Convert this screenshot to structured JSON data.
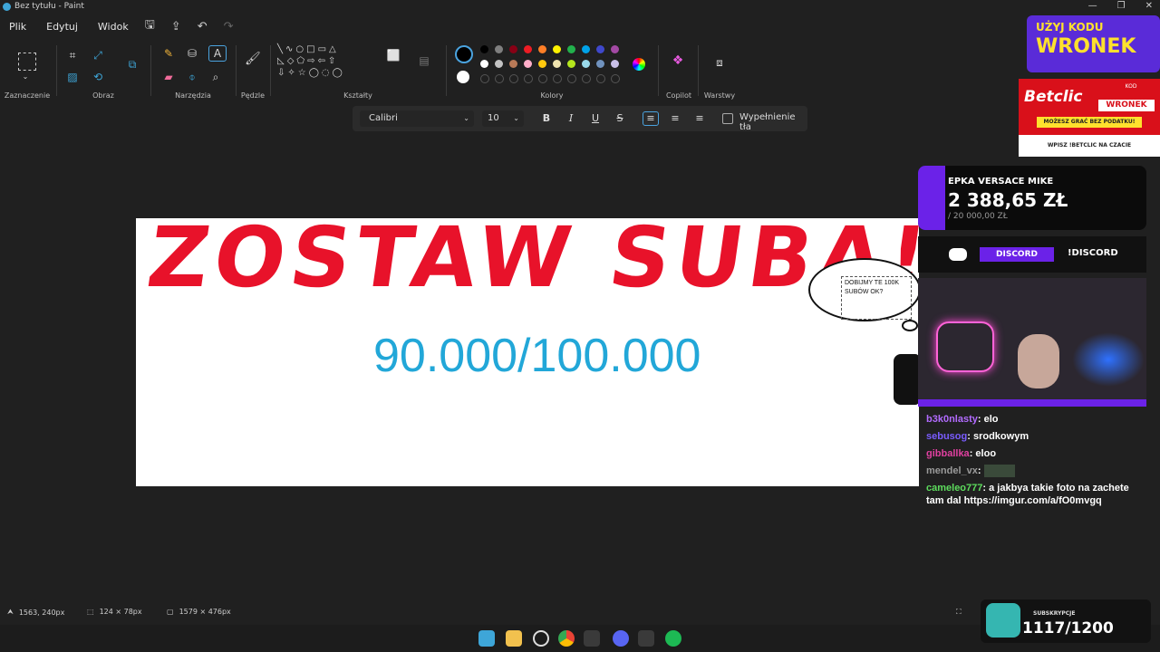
{
  "window": {
    "title": "Bez tytułu - Paint",
    "controls": [
      "—",
      "❐",
      "✕"
    ]
  },
  "menu": {
    "items": [
      "Plik",
      "Edytuj",
      "Widok"
    ]
  },
  "ribbon": {
    "groups": [
      "Zaznaczenie",
      "Obraz",
      "Narzędzia",
      "Pędzle",
      "Kształty",
      "Kolory",
      "Copilot",
      "Warstwy"
    ]
  },
  "palette": {
    "primary": "#000000",
    "secondary": "#ffffff",
    "row1": [
      "#000000",
      "#7f7f7f",
      "#880015",
      "#ed1c24",
      "#ff7f27",
      "#fff200",
      "#22b14c",
      "#00a2e8",
      "#3f48cc",
      "#a349a4"
    ],
    "row2": [
      "#ffffff",
      "#c3c3c3",
      "#b97a57",
      "#ffaec9",
      "#ffc90e",
      "#efe4b0",
      "#b5e61d",
      "#99d9ea",
      "#7092be",
      "#c8bfe7"
    ]
  },
  "textbar": {
    "font": "Calibri",
    "size": "10",
    "fill_label": "Wypełnienie tła"
  },
  "canvas": {
    "headline": "ZOSTAW SUBA!",
    "counter": "90.000/100.000",
    "bubble_text": "DOBIJMY TE 100K SUBÓW OK?"
  },
  "statusbar": {
    "cursor": "1563, 240px",
    "selection": "124 × 78px",
    "image_size": "1579 × 476px"
  },
  "overlay": {
    "promo_line1": "UŻYJ KODU",
    "promo_line2": "WRONEK",
    "betclic_brand": "Betclic",
    "betclic_kod_label": "KOD",
    "betclic_kod": "WRONEK",
    "betclic_strip": "MOŻESZ GRAĆ BEZ PODATKU!",
    "betclic_footer": "WPISZ !BETCLIC NA CZACIE",
    "goal_title": "EPKA VERSACE MIKE",
    "goal_amount": "2 388,65 ZŁ",
    "goal_target": "/ 20 000,00 ZŁ",
    "discord_label": "DISCORD",
    "discord_cmd": "!DISCORD",
    "chat": [
      {
        "user": "b3k0nlasty",
        "color": "#b26bff",
        "text": "elo"
      },
      {
        "user": "sebusog",
        "color": "#7a5cff",
        "text": "srodkowym"
      },
      {
        "user": "gibballka",
        "color": "#e040a0",
        "text": "eloo"
      },
      {
        "user": "mendel_vx",
        "color": "#9a9a9a",
        "text": ""
      },
      {
        "user": "cameleo777",
        "color": "#5ddc5d",
        "text": "a jakbya takie foto na zachete tam dal https://imgur.com/a/fO0mvgq"
      }
    ],
    "subs_label": "SUBSKRYPCJE",
    "subs_value": "1117/1200"
  }
}
